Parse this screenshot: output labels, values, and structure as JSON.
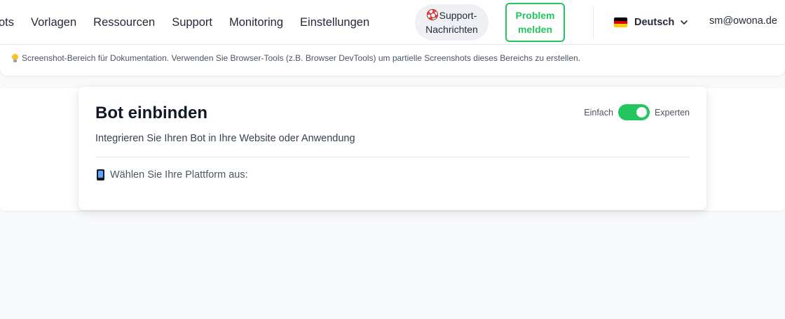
{
  "nav": {
    "links": [
      "ots",
      "Vorlagen",
      "Ressourcen",
      "Support",
      "Monitoring",
      "Einstellungen"
    ],
    "support_line1": "Support-",
    "support_line2": "Nachrichten",
    "support_icon": "lifebuoy-icon",
    "problem_line1": "Problem",
    "problem_line2": "melden",
    "language": "Deutsch",
    "language_icon": "germany-flag-icon",
    "user_email": "sm@owona.de"
  },
  "info": {
    "icon": "lightbulb-icon",
    "text": "Screenshot-Bereich für Dokumentation. Verwenden Sie Browser-Tools (z.B. Browser DevTools) um partielle Screenshots dieses Bereichs zu erstellen."
  },
  "embed": {
    "title": "Bot einbinden",
    "subtitle": "Integrieren Sie Ihren Bot in Ihre Website oder Anwendung",
    "mode_left": "Einfach",
    "mode_right": "Experten",
    "mode_expert_on": true,
    "platform_icon": "mobile-phone-icon",
    "platform_label": "Wählen Sie Ihre Plattform aus:"
  },
  "colors": {
    "accent_green": "#22c55e",
    "page_bg": "#f8f9fb",
    "text_dark": "#1f2937"
  }
}
